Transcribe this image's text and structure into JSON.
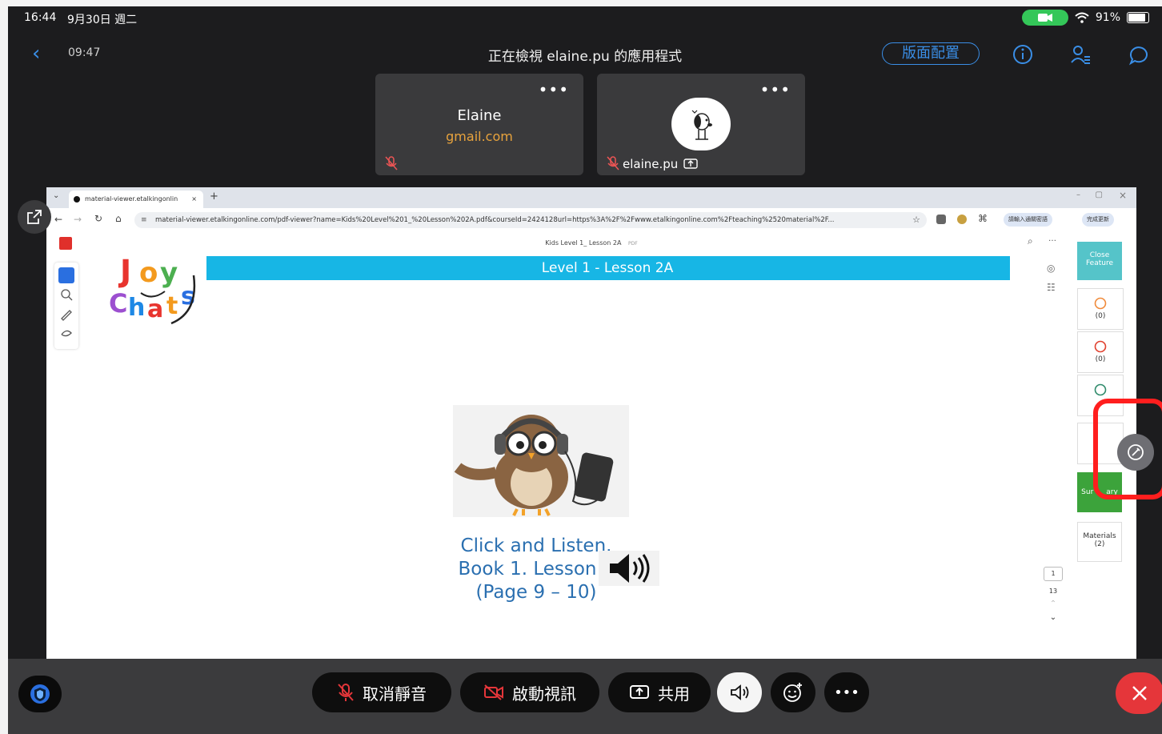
{
  "status_bar": {
    "time": "16:44",
    "date": "9月30日 週二",
    "battery": "91%"
  },
  "top_bar": {
    "elapsed": "09:47",
    "title": "正在檢視 elaine.pu 的應用程式",
    "layout_button": "版面配置"
  },
  "participants": [
    {
      "name": "Elaine",
      "email": "gmail.com",
      "more": "•••"
    },
    {
      "name": "elaine.pu",
      "more": "•••"
    }
  ],
  "browser": {
    "tab_title": "material-viewer.etalkingonlin",
    "tab_close": "×",
    "new_tab": "+",
    "url": "material-viewer.etalkingonline.com/pdf-viewer?name=Kids%20Level%201_%20Lesson%202A.pdf&courseId=2424128url=https%3A%2F%2Fwww.etalkingonline.com%2Fteaching%2520material%2F...",
    "ext_label_1": "請輸入通關密語",
    "ext_label_2": "完成更新",
    "pdf_title": "Kids Level 1_ Lesson 2A",
    "pdf_badge": "PDF"
  },
  "lesson": {
    "banner": "Level 1 - Lesson 2A",
    "caption_lines": [
      "Click and Listen.",
      "Book 1. Lesson 2",
      "(Page 9 – 10)"
    ]
  },
  "right_panel": {
    "close_feature": "Close Feature",
    "count_1": "(0)",
    "count_2": "(0)",
    "summary_partial_left": "Sur",
    "summary_partial_right": "ary",
    "materials": "Materials",
    "materials_count": "(2)"
  },
  "page_nav": {
    "current": "1",
    "total": "13"
  },
  "bottom_bar": {
    "unmute": "取消靜音",
    "start_video": "啟動視訊",
    "share": "共用",
    "more": "•••"
  },
  "colors": {
    "accent_blue": "#3a8ee6",
    "banner": "#17b6e5",
    "end_call": "#e5363a",
    "highlight": "#ff1e1e"
  }
}
